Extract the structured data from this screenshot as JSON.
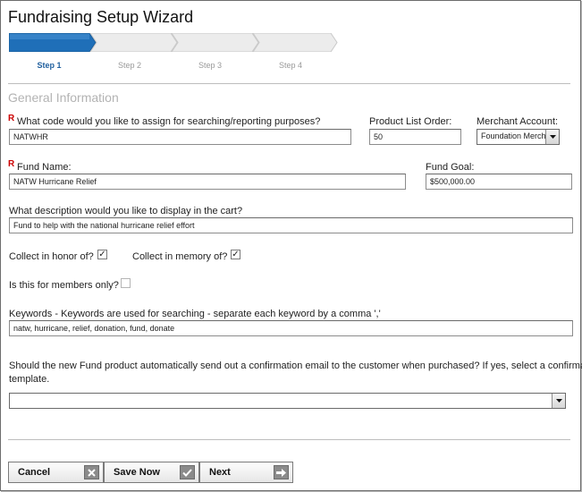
{
  "title": "Fundraising Setup Wizard",
  "steps": [
    {
      "label": "Step 1",
      "active": true
    },
    {
      "label": "Step 2",
      "active": false
    },
    {
      "label": "Step 3",
      "active": false
    },
    {
      "label": "Step 4",
      "active": false
    }
  ],
  "colors": {
    "step_active": "#1f6fb8",
    "step_inactive": "#ececec",
    "required": "#cc0000",
    "section_title": "#b3b3b3"
  },
  "section": {
    "title": "General Information"
  },
  "fields": {
    "code": {
      "required_mark": "R",
      "label": "What code would you like to assign for searching/reporting purposes?",
      "value": "NATWHR"
    },
    "list_order": {
      "label": "Product List Order:",
      "value": "50"
    },
    "merchant": {
      "label": "Merchant Account:",
      "value": "Foundation Merch"
    },
    "fund_name": {
      "required_mark": "R",
      "label": "Fund Name:",
      "value": "NATW Hurricane Relief"
    },
    "fund_goal": {
      "label": "Fund Goal:",
      "value": "$500,000.00"
    },
    "description": {
      "label": "What description would you like to display in the cart?",
      "value": "Fund to help with the national hurricane relief effort"
    },
    "honor": {
      "label": "Collect in honor of?",
      "checked": true,
      "mark": "✓"
    },
    "memory": {
      "label": "Collect in memory of?",
      "checked": true,
      "mark": "✓"
    },
    "members_only": {
      "label": "Is this for members only?",
      "checked": false,
      "mark": ""
    },
    "keywords": {
      "label": "Keywords - Keywords are used for searching - separate each keyword by a comma ','",
      "value": "natw, hurricane, relief, donation, fund, donate"
    },
    "email_template": {
      "label_line1": "Should the new Fund product automatically send out a confirmation email to the customer when purchased? If yes, select a confirmation",
      "label_line2": "template.",
      "value": ""
    }
  },
  "buttons": {
    "cancel": {
      "label": "Cancel",
      "icon": "close-icon"
    },
    "save": {
      "label": "Save Now",
      "icon": "checkmark-icon"
    },
    "next": {
      "label": "Next",
      "icon": "arrow-right-icon"
    }
  }
}
